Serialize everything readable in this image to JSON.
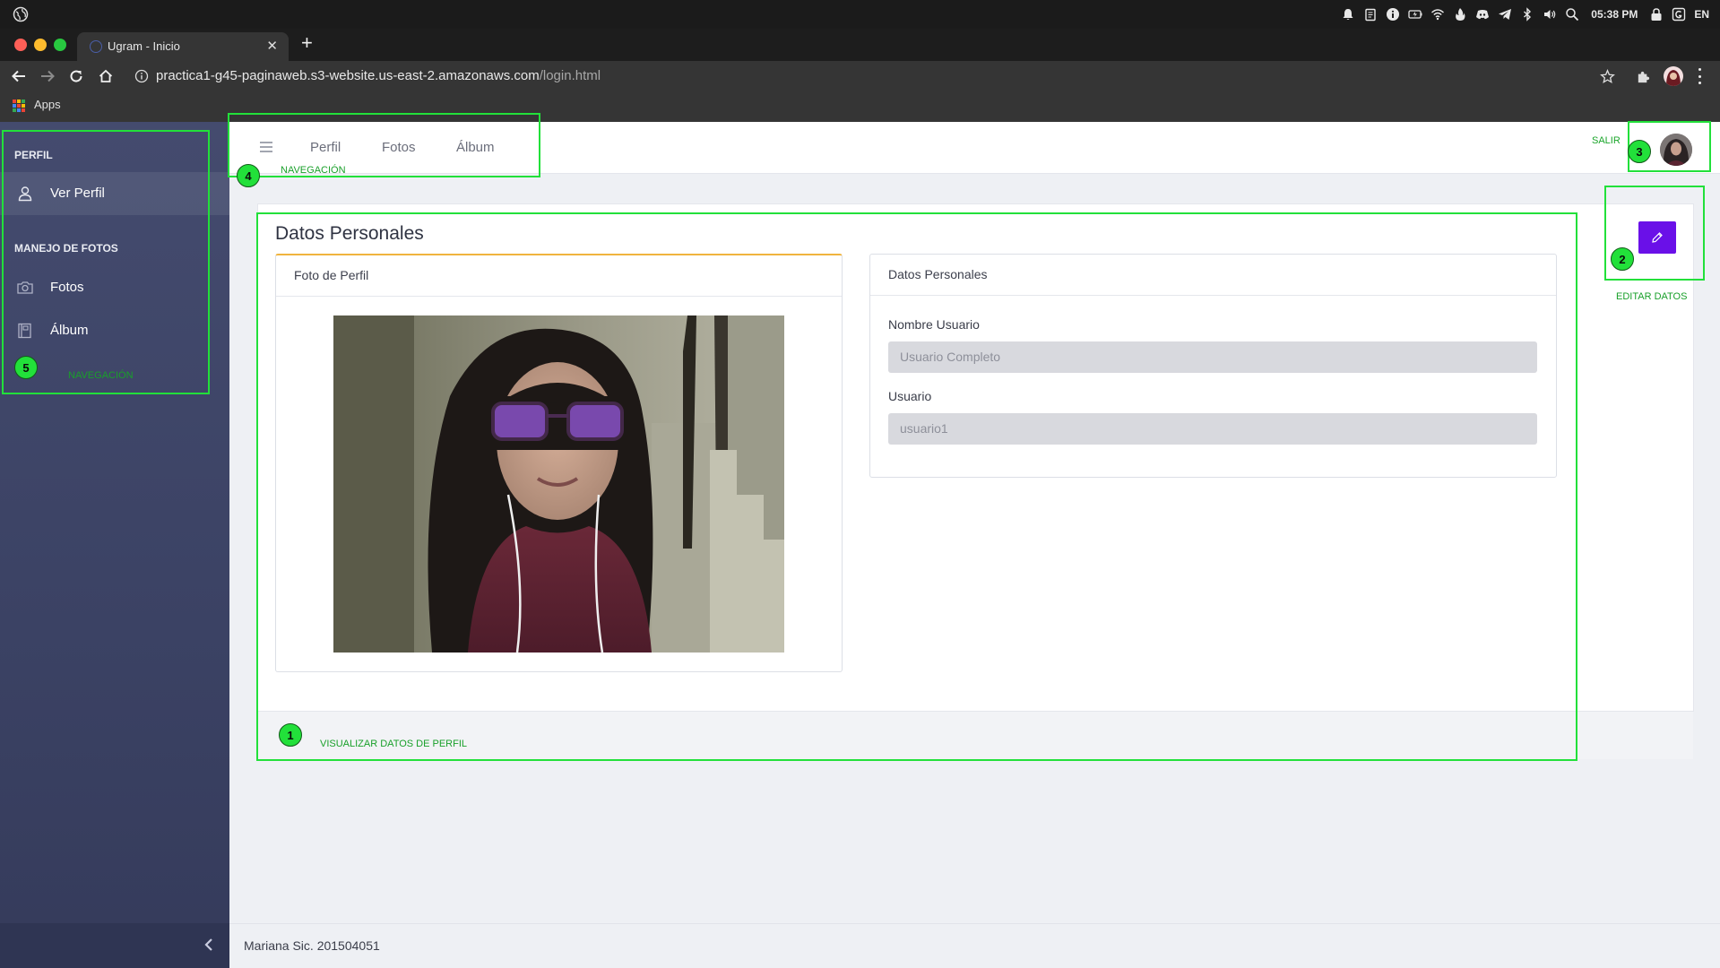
{
  "os": {
    "clock": "05:38 PM",
    "language": "EN",
    "tray_icons": [
      "bell-icon",
      "clipboard-icon",
      "info-icon",
      "battery-icon",
      "wifi-icon",
      "flame-icon",
      "discord-icon",
      "telegram-icon",
      "bluetooth-icon",
      "volume-icon",
      "search-icon",
      "lock-icon",
      "app-icon"
    ]
  },
  "browser": {
    "tab_title": "Ugram - Inicio",
    "url_host": "practica1-g45-paginaweb.s3-website.us-east-2.amazonaws.com",
    "url_path": "/login.html",
    "bookmarks_apps": "Apps"
  },
  "sidebar": {
    "section_profile": "PERFIL",
    "item_profile": "Ver Perfil",
    "section_photos": "MANEJO DE FOTOS",
    "item_photos": "Fotos",
    "item_album": "Álbum"
  },
  "topnav": {
    "links": [
      "Perfil",
      "Fotos",
      "Álbum"
    ],
    "logout": "SALIR"
  },
  "main": {
    "title": "Datos Personales",
    "photo_panel_title": "Foto de Perfil",
    "data_panel_title": "Datos Personales",
    "field_name_label": "Nombre Usuario",
    "field_name_placeholder": "Usuario Completo",
    "field_user_label": "Usuario",
    "field_user_placeholder": "usuario1"
  },
  "footer": {
    "text": "Mariana Sic. 201504051"
  },
  "annotations": {
    "box1": {
      "number": "1",
      "label": "VISUALIZAR DATOS DE PERFIL"
    },
    "box2": {
      "number": "2",
      "label": "EDITAR DATOS"
    },
    "box3": {
      "number": "3"
    },
    "box4": {
      "number": "4",
      "label": "NAVEGACIÓN"
    },
    "box5": {
      "number": "5",
      "label": "NAVEGACIÓN"
    }
  },
  "colors": {
    "sidebar_bg": "#3f4669",
    "accent_edit": "#6a10e8",
    "annotation": "#22e03a",
    "panel_accent": "#f0b43e"
  }
}
